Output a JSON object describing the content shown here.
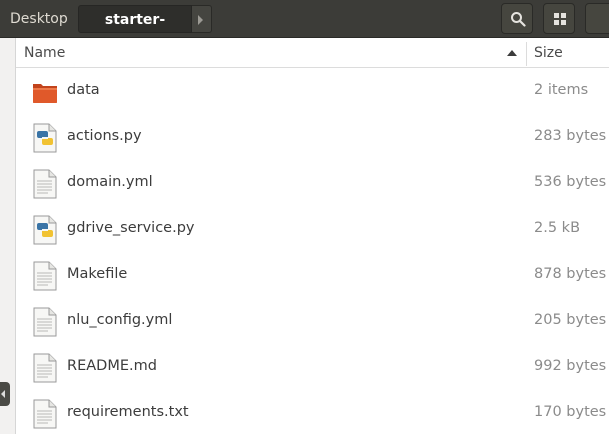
{
  "breadcrumbs": {
    "items": [
      "Desktop",
      "starter-pack"
    ]
  },
  "toolbar": {
    "search_icon": "search-icon",
    "view_icon": "grid-view-icon"
  },
  "columns": {
    "name": "Name",
    "size": "Size"
  },
  "files": [
    {
      "name": "data",
      "size": "2 items",
      "icon": "folder-icon"
    },
    {
      "name": "actions.py",
      "size": "283 bytes",
      "icon": "python-file-icon"
    },
    {
      "name": "domain.yml",
      "size": "536 bytes",
      "icon": "text-file-icon"
    },
    {
      "name": "gdrive_service.py",
      "size": "2.5 kB",
      "icon": "python-file-icon"
    },
    {
      "name": "Makefile",
      "size": "878 bytes",
      "icon": "text-file-icon"
    },
    {
      "name": "nlu_config.yml",
      "size": "205 bytes",
      "icon": "text-file-icon"
    },
    {
      "name": "README.md",
      "size": "992 bytes",
      "icon": "text-file-icon"
    },
    {
      "name": "requirements.txt",
      "size": "170 bytes",
      "icon": "text-file-icon"
    }
  ],
  "colors": {
    "header_bg": "#3c3c38",
    "folder_orange": "#e0592a",
    "size_text": "#8b8b8b"
  }
}
